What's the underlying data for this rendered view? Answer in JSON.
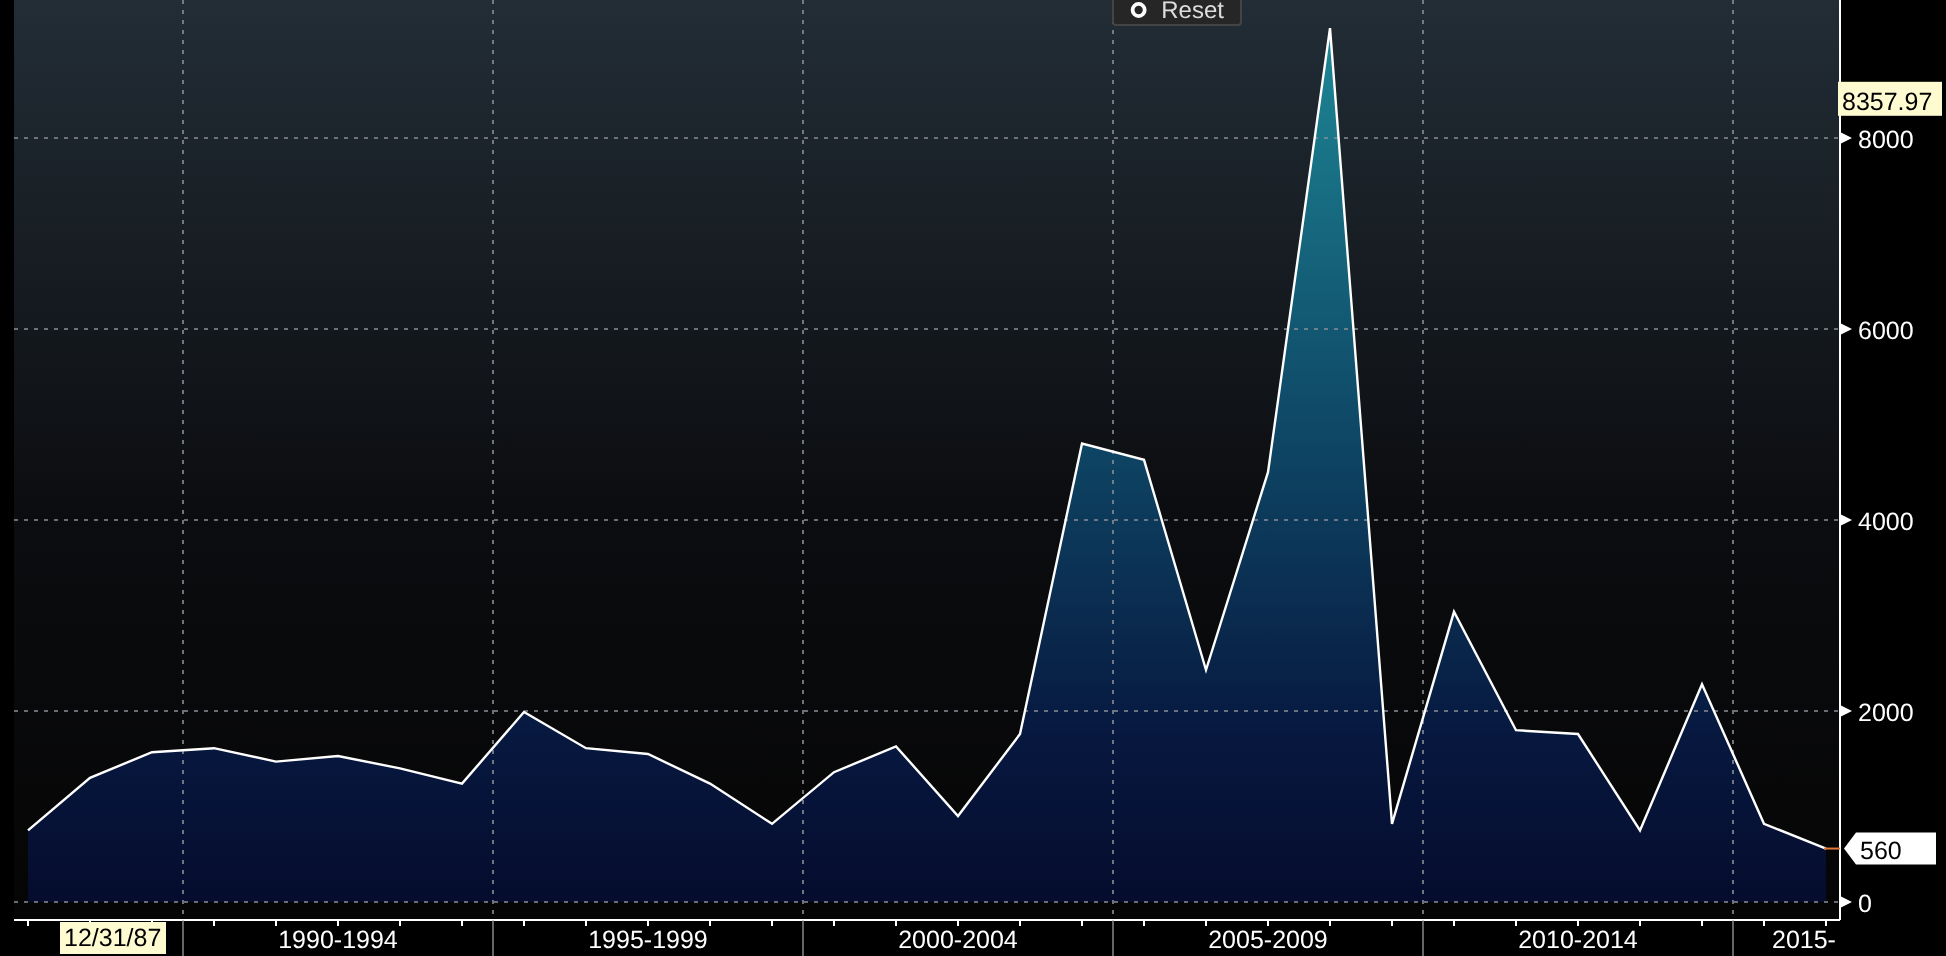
{
  "reset_button": {
    "label": "Reset"
  },
  "cursor_date": "12/31/87",
  "value_labels": [
    {
      "kind": "marker",
      "text": "8357.97"
    },
    {
      "kind": "last",
      "text": "560"
    }
  ],
  "chart_data": {
    "type": "area",
    "categories": [
      null,
      null,
      null,
      null,
      null,
      "1990-1994",
      null,
      null,
      null,
      null,
      "1995-1999",
      null,
      null,
      null,
      null,
      "2000-2004",
      null,
      null,
      null,
      null,
      "2005-2009",
      null,
      null,
      null,
      null,
      "2010-2014",
      null,
      null,
      null,
      "2015-"
    ],
    "series": [
      {
        "color": "#ffffff",
        "values": [
          750,
          1300,
          1570,
          1610,
          1470,
          1530,
          1400,
          1240,
          1990,
          1610,
          1550,
          1240,
          820,
          1360,
          1630,
          900,
          1760,
          4800,
          4630,
          2430,
          4500,
          9150,
          820,
          3040,
          1800,
          1760,
          750,
          2280,
          820,
          560
        ]
      }
    ],
    "ylim": [
      -188,
      9445
    ],
    "yticks": [
      0,
      2000,
      4000,
      6000,
      8000
    ],
    "grid": true
  }
}
